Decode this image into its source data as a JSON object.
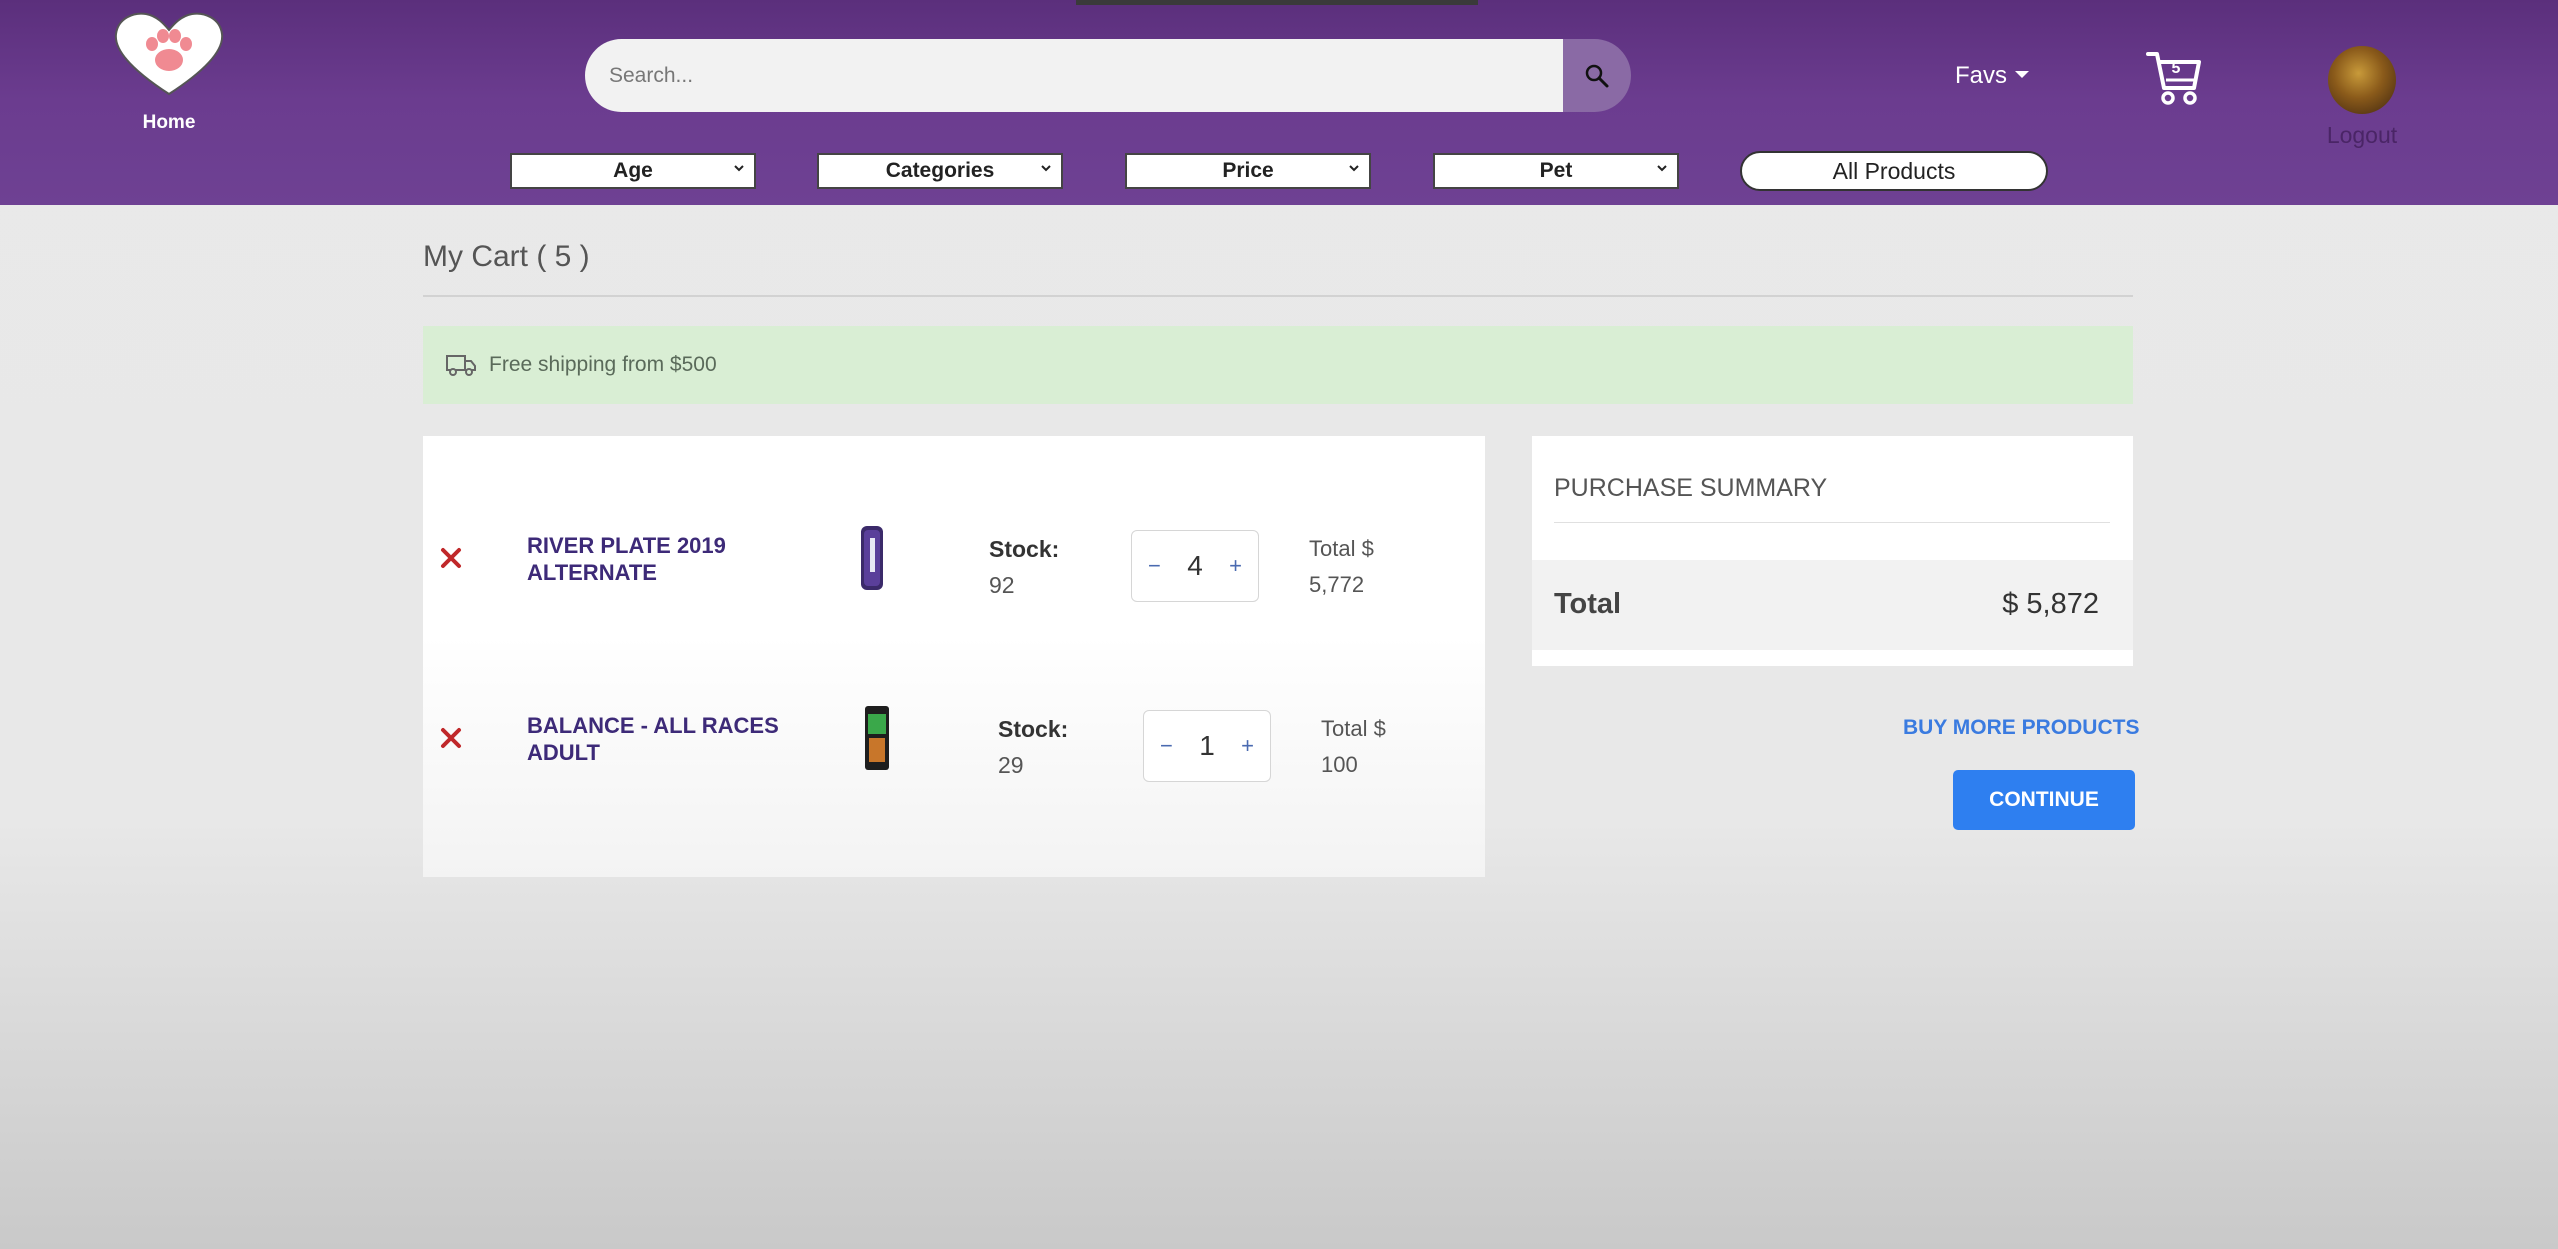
{
  "header": {
    "home_label": "Home",
    "search_placeholder": "Search...",
    "favs_label": "Favs",
    "cart_count": "5",
    "logout_label": "Logout",
    "filters": [
      "Age",
      "Categories",
      "Price",
      "Pet"
    ],
    "all_products_label": "All Products"
  },
  "cart": {
    "title": "My Cart ( 5 )",
    "shipping_notice": "Free shipping from $500",
    "items": [
      {
        "name": "RIVER PLATE 2019 ALTERNATE",
        "stock_label": "Stock:",
        "stock": "92",
        "qty_minus": "−",
        "quantity": "4",
        "qty_plus": "+",
        "total_label": "Total $",
        "total": "5,772"
      },
      {
        "name": "BALANCE - ALL RACES ADULT",
        "stock_label": "Stock:",
        "stock": "29",
        "qty_minus": "−",
        "quantity": "1",
        "qty_plus": "+",
        "total_label": "Total $",
        "total": "100"
      }
    ]
  },
  "summary": {
    "title": "PURCHASE SUMMARY",
    "total_label": "Total",
    "total_value": "$ 5,872"
  },
  "actions": {
    "buy_more": "BUY MORE PRODUCTS",
    "continue": "CONTINUE"
  },
  "colors": {
    "header": "#6b3c8f",
    "accent_blue": "#2e7ff0",
    "product_name": "#3d2a78",
    "remove": "#c0282a",
    "shipping_bg": "#d9eed4"
  }
}
